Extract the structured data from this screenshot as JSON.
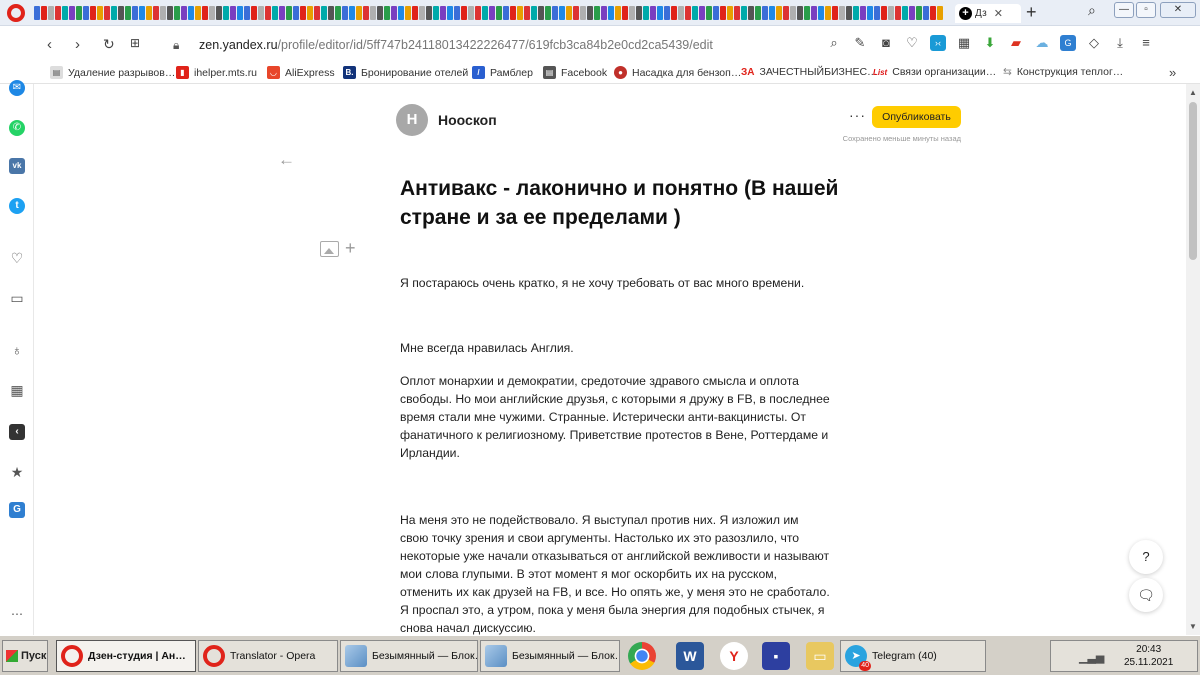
{
  "browser": {
    "active_tab_label": "Дз",
    "address": {
      "host": "zen.yandex.ru",
      "path": "/profile/editor/id/5ff747b24118013422226477/619fcb3ca84b2e0cd2ca5439/edit"
    },
    "bookmarks": [
      "Удаление разрывов…",
      "ihelper.mts.ru",
      "AliExpress",
      "Бронирование отелей",
      "Рамблер",
      "Facebook",
      "Насадка для бензоп…",
      "ЗАЧЕСТНЫЙБИЗНЕС…",
      "Связи организации…",
      "Конструкция теплог…"
    ],
    "bookmark_prefix_3a": "ЗА",
    "bookmark_prefix_list": "List",
    "bookmark_prefix_b": "B."
  },
  "editor": {
    "channel_avatar_letter": "Н",
    "channel_name": "Нооскоп",
    "more_label": "···",
    "publish_label": "Опубликовать",
    "saved_status": "Сохранено меньше минуты назад",
    "title": "Антивакс - лаконично и понятно (В нашей стране и за ее пределами )",
    "paragraphs": [
      "Я постараюсь очень кратко, я не хочу требовать от вас много времени.",
      "Мне всегда нравилась Англия.",
      "Оплот монархии и демократии, средоточие здравого смысла и оплота свободы. Но мои английские друзья, с которыми я дружу в FB, в последнее время стали мне чужими. Странные. Истерически анти-вакцинисты. От фанатичного к религиозному. Приветствие протестов в Вене, Роттердаме и Ирландии.",
      "На меня это не подействовало. Я выступал против них. Я изложил им свою точку зрения и свои аргументы. Настолько их это разозлило, что некоторые уже начали отказываться от английской вежливости и называют мои слова глупыми. В этот момент я мог оскорбить их на русском, отменить их как друзей на FB, и все. Но опять же, у меня это не сработало. Я проспал это, а утром, пока у меня была энергия для подобных стычек, я снова начал дискуссию."
    ],
    "help_label": "?"
  },
  "taskbar": {
    "start_label": "Пуск",
    "windows": [
      "Дзен-студия | Ан…",
      "Translator - Opera",
      "Безымянный — Блок…",
      "Безымянный — Блок…",
      "Telegram (40)"
    ],
    "telegram_badge": "40",
    "time": "20:43",
    "date": "25.11.2021"
  },
  "colors": {
    "publish_button": "#ffcc00",
    "opera_red": "#e0231a",
    "taskbar": "#d4d0c8"
  }
}
